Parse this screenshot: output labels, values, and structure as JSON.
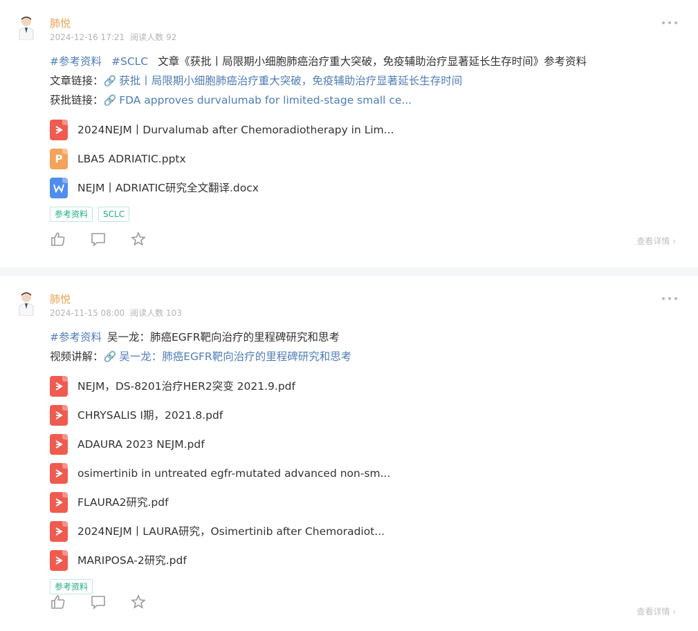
{
  "posts": [
    {
      "author": "肺悦",
      "date": "2024-12-16 17:21",
      "reads": "阅读人数 92",
      "hashtags": [
        "#参考资料",
        "#SCLC"
      ],
      "text": "文章《获批丨局限期小细胞肺癌治疗重大突破，免疫辅助治疗显著延长生存时间》参考资料",
      "links": [
        {
          "label": "文章链接：",
          "text": "获批丨局限期小细胞肺癌治疗重大突破，免疫辅助治疗显著延长生存时间"
        },
        {
          "label": "获批链接：",
          "text": "FDA approves durvalumab for limited-stage small ce..."
        }
      ],
      "files": [
        {
          "type": "pdf",
          "name": "2024NEJM丨Durvalumab after Chemoradiotherapy in Lim..."
        },
        {
          "type": "ppt",
          "name": "LBA5 ADRIATIC.pptx"
        },
        {
          "type": "doc",
          "name": "NEJM丨ADRIATIC研究全文翻译.docx"
        }
      ],
      "tags": [
        "参考资料",
        "SCLC"
      ],
      "detail": "查看详情"
    },
    {
      "author": "肺悦",
      "date": "2024-11-15 08:00",
      "reads": "阅读人数 103",
      "hashtags": [
        "#参考资料"
      ],
      "text": "吴一龙：肺癌EGFR靶向治疗的里程碑研究和思考",
      "links": [
        {
          "label": "视频讲解：",
          "text": "吴一龙：肺癌EGFR靶向治疗的里程碑研究和思考"
        }
      ],
      "files": [
        {
          "type": "pdf",
          "name": "NEJM，DS-8201治疗HER2突变 2021.9.pdf"
        },
        {
          "type": "pdf",
          "name": "CHRYSALIS I期，2021.8.pdf"
        },
        {
          "type": "pdf",
          "name": "ADAURA 2023 NEJM.pdf"
        },
        {
          "type": "pdf",
          "name": "osimertinib in untreated egfr-mutated advanced non-sm..."
        },
        {
          "type": "pdf",
          "name": "FLAURA2研究.pdf"
        },
        {
          "type": "pdf",
          "name": "2024NEJM丨LAURA研究，Osimertinib after Chemoradiot..."
        },
        {
          "type": "pdf",
          "name": "MARIPOSA-2研究.pdf"
        }
      ],
      "tags": [
        "参考资料"
      ],
      "detail": "查看详情"
    }
  ],
  "icons": {
    "file_pdf_color": "#ef5b4f",
    "file_ppt_color": "#f3a35a",
    "file_doc_color": "#4f8df0",
    "author_color": "#e8a04f",
    "link_color": "#4f7db8",
    "tag_color": "#1fae7e"
  }
}
